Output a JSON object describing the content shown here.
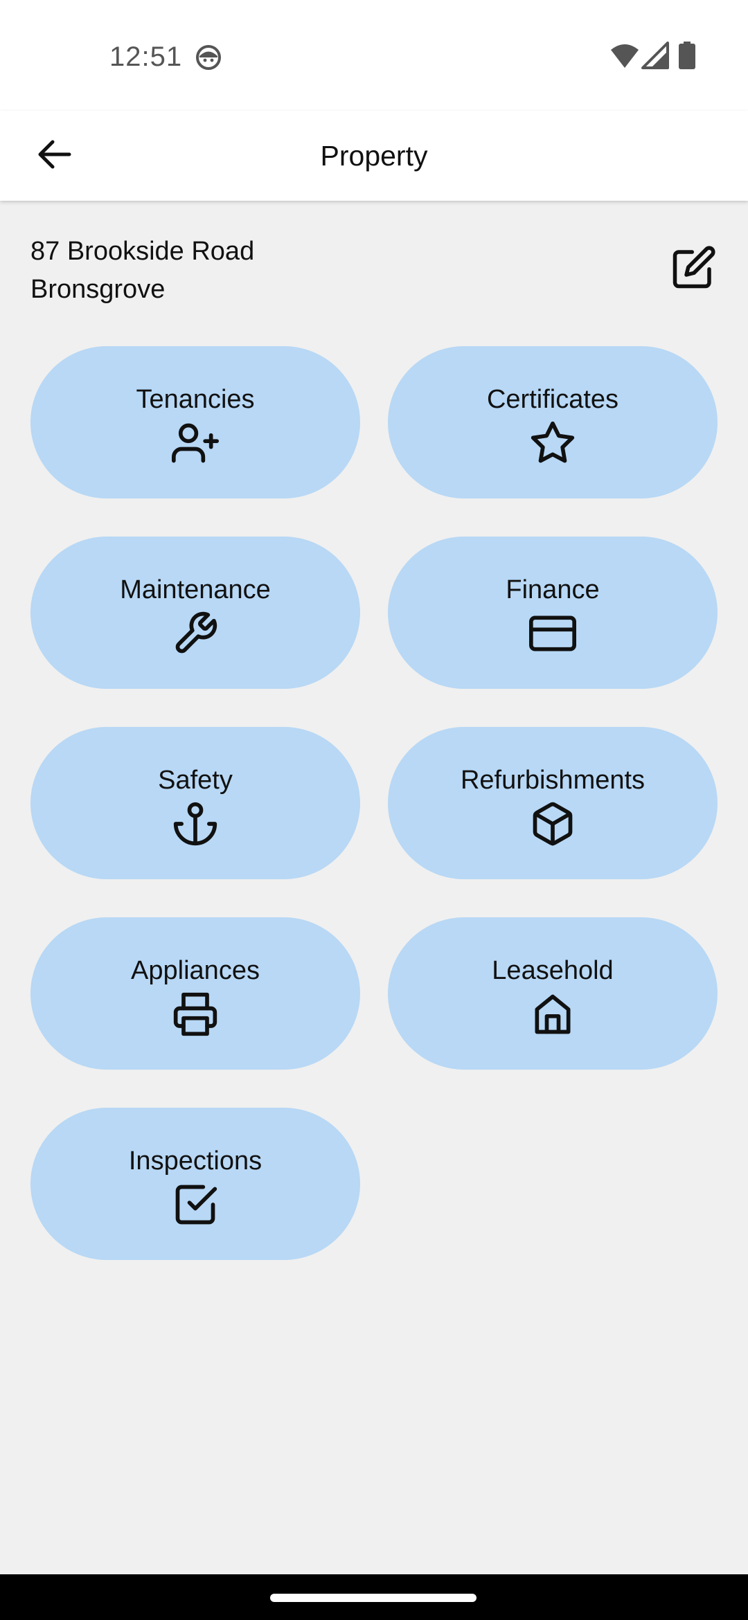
{
  "status_bar": {
    "time": "12:51",
    "icons": [
      "notification-face-icon",
      "wifi-icon",
      "cell-signal-icon",
      "battery-icon"
    ]
  },
  "app_bar": {
    "title": "Property",
    "back_icon": "arrow-left-icon"
  },
  "property": {
    "address_line1": "87 Brookside Road",
    "address_line2": "Bronsgrove",
    "edit_icon": "edit-icon"
  },
  "tiles": [
    {
      "label": "Tenancies",
      "icon": "user-plus-icon"
    },
    {
      "label": "Certificates",
      "icon": "star-icon"
    },
    {
      "label": "Maintenance",
      "icon": "wrench-icon"
    },
    {
      "label": "Finance",
      "icon": "credit-card-icon"
    },
    {
      "label": "Safety",
      "icon": "anchor-icon"
    },
    {
      "label": "Refurbishments",
      "icon": "package-icon"
    },
    {
      "label": "Appliances",
      "icon": "printer-icon"
    },
    {
      "label": "Leasehold",
      "icon": "home-icon"
    },
    {
      "label": "Inspections",
      "icon": "check-square-icon"
    }
  ],
  "colors": {
    "background": "#f0f0f0",
    "app_bar": "#ffffff",
    "tile": "#b8d8f5",
    "text": "#111111",
    "nav_bar": "#000000"
  }
}
